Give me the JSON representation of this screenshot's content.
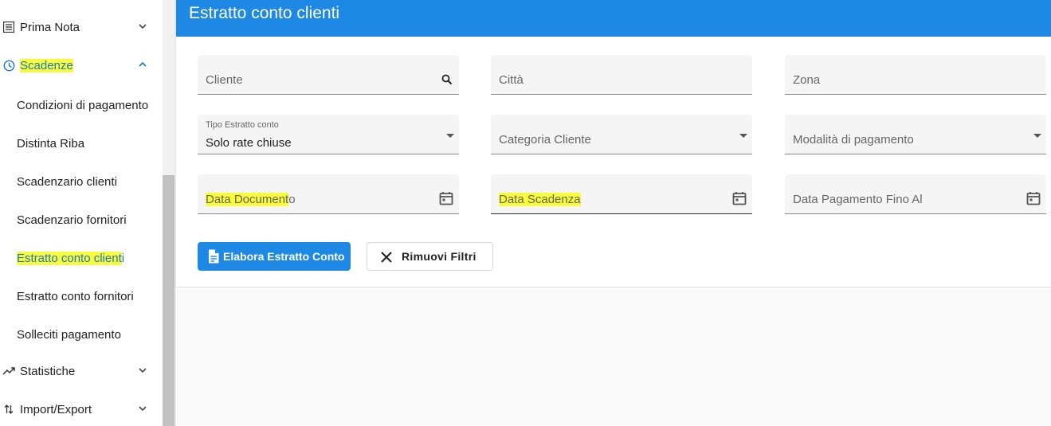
{
  "sidebar": {
    "prima_nota": "Prima Nota",
    "scadenze": "Scadenze",
    "sub_items": {
      "condizioni": "Condizioni di pagamento",
      "distinta": "Distinta Riba",
      "scad_clienti": "Scadenzario clienti",
      "scad_fornitori": "Scadenzario fornitori",
      "estratto_clienti_hl": "Estratto conto client",
      "estratto_clienti_rest": "i",
      "estratto_fornitori": "Estratto conto fornitori",
      "solleciti": "Solleciti pagamento"
    },
    "statistiche": "Statistiche",
    "import_export": "Import/Export"
  },
  "header": {
    "title": "Estratto conto clienti"
  },
  "form": {
    "cliente": "Cliente",
    "citta": "Città",
    "zona": "Zona",
    "tipo_label": "Tipo Estratto conto",
    "tipo_value": "Solo rate chiuse",
    "categoria": "Categoria Cliente",
    "modalita": "Modalità di pagamento",
    "data_doc_hl": "Data Document",
    "data_doc_rest": "o",
    "data_scadenza": "Data Scadenza",
    "data_pagamento": "Data Pagamento Fino Al"
  },
  "buttons": {
    "elabora": "Elabora Estratto Conto",
    "rimuovi": "Rimuovi Filtri"
  },
  "colors": {
    "accent": "#1e88e5",
    "highlight": "#f7fb3a"
  },
  "icons": [
    "list-icon",
    "clock-icon",
    "trending-up-icon",
    "import-export-icon",
    "search-icon",
    "calendar-icon",
    "document-icon",
    "close-icon",
    "chevron-down-icon",
    "chevron-up-icon",
    "dropdown-arrow-icon"
  ]
}
